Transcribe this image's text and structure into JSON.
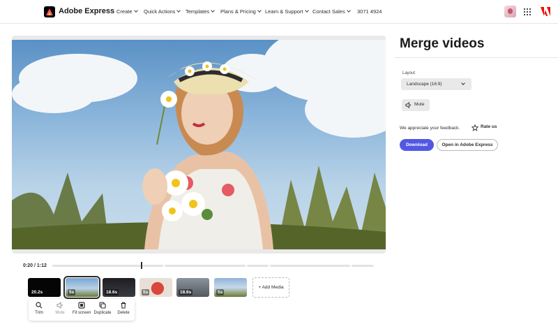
{
  "header": {
    "brand": "Adobe Express",
    "nav": [
      {
        "label": "Create"
      },
      {
        "label": "Quick Actions"
      },
      {
        "label": "Templates"
      },
      {
        "label": "Plans & Pricing"
      },
      {
        "label": "Learn & Support"
      },
      {
        "label": "Contact Sales"
      }
    ],
    "phone": "3071 4924",
    "icons": [
      "adobe-express-logo",
      "user-avatar",
      "apps-grid-icon",
      "adobe-logo"
    ]
  },
  "player": {
    "current_time": "0:20",
    "separator": "/",
    "total_time": "1:12",
    "progress": 0.28
  },
  "clips": [
    {
      "duration": "20.2s",
      "selected": false
    },
    {
      "duration": "5s",
      "selected": true
    },
    {
      "duration": "18.6s",
      "selected": false
    },
    {
      "duration": "5s",
      "selected": false
    },
    {
      "duration": "18.6s",
      "selected": false
    },
    {
      "duration": "5s",
      "selected": false
    }
  ],
  "add_media_label": "+ Add Media",
  "clip_toolbar": {
    "trim": "Trim",
    "mute": "Mute",
    "fit_screen": "Fit screen",
    "duplicate": "Duplicate",
    "delete": "Delete"
  },
  "panel": {
    "title": "Merge videos",
    "layout_label": "Layout",
    "layout_value": "Landscape (16:9)",
    "mute_label": "Mute",
    "feedback_text": "We appreciate your feedback.",
    "rate_label": "Rate us",
    "download_label": "Download",
    "open_label": "Open in Adobe Express"
  },
  "colors": {
    "accent": "#5258e4",
    "text": "#2c2c2c",
    "panel_bg": "#e9e9e9"
  }
}
